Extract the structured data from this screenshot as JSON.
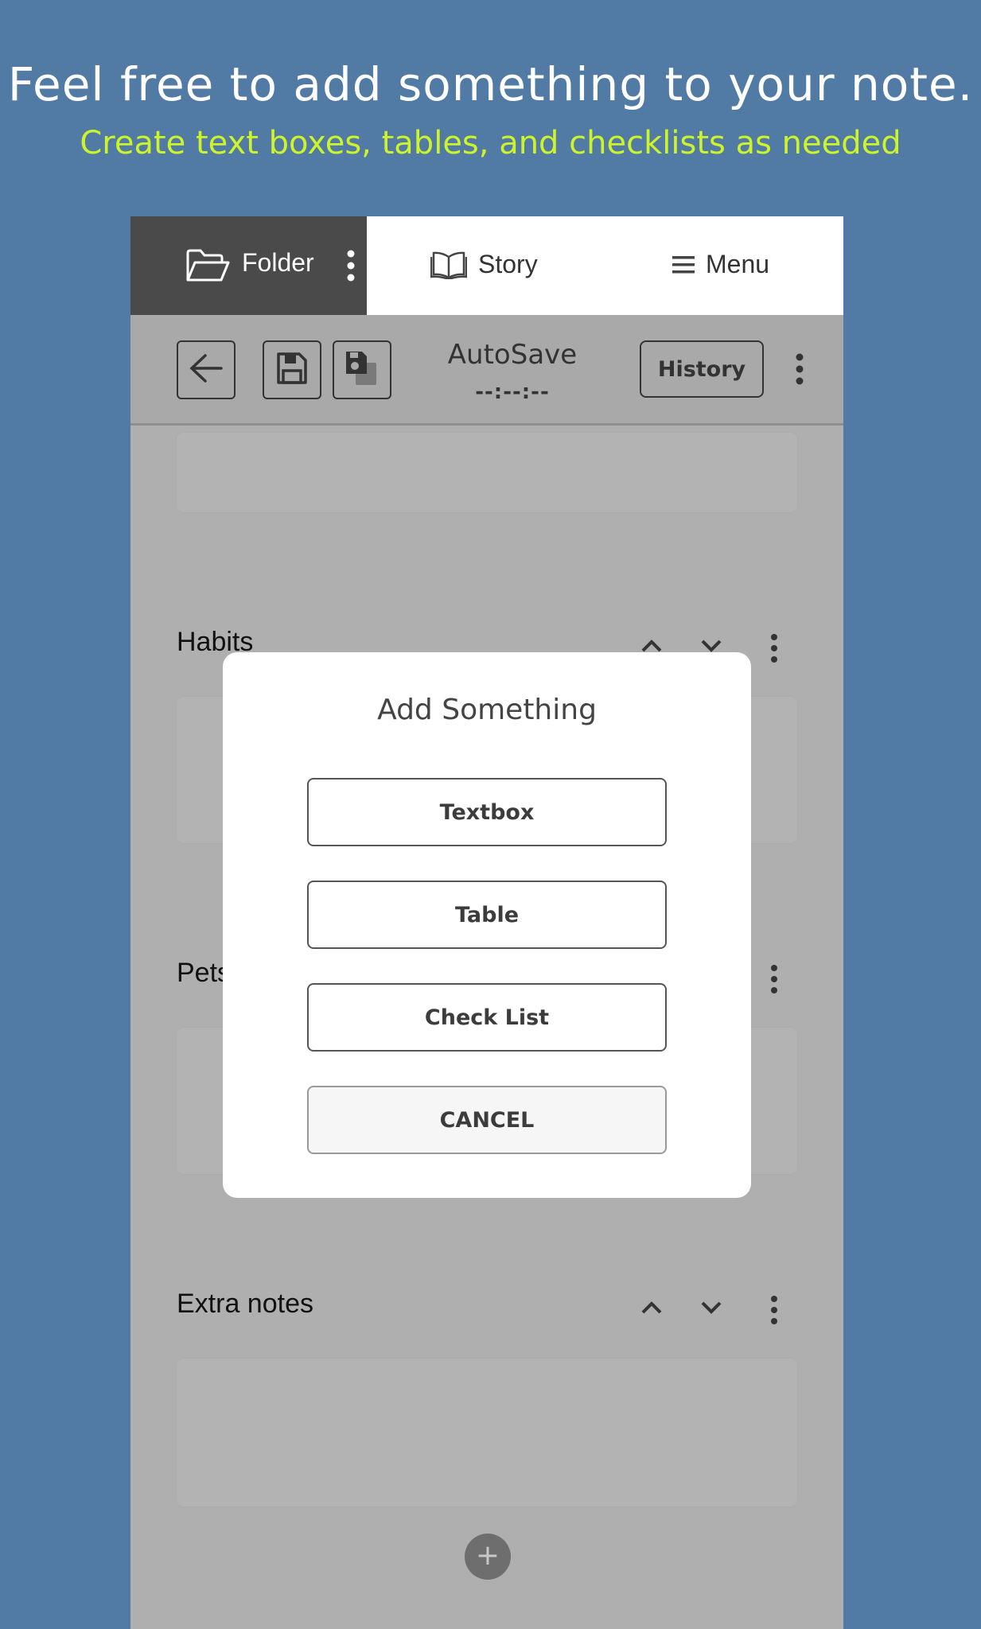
{
  "promo": {
    "title": "Feel free to add something to your note.",
    "subtitle": "Create text boxes, tables, and checklists as needed"
  },
  "topnav": {
    "folder": {
      "label": "Folder",
      "icon": "folder-open-icon"
    },
    "story": {
      "label": "Story",
      "icon": "book-open-icon"
    },
    "menu": {
      "label": "Menu",
      "icon": "hamburger-icon"
    }
  },
  "toolbar": {
    "back_icon": "arrow-left-icon",
    "save_icon": "floppy-disk-icon",
    "save_as_icon": "floppy-disk-copy-icon",
    "autosave_label": "AutoSave",
    "autosave_time": "--:--:--",
    "history_label": "History"
  },
  "sections": [
    {
      "title": "Habits"
    },
    {
      "title": "Pets"
    },
    {
      "title": "Extra notes"
    }
  ],
  "dialog": {
    "title": "Add Something",
    "buttons": {
      "textbox": "Textbox",
      "table": "Table",
      "checklist": "Check List",
      "cancel": "CANCEL"
    }
  },
  "fab": {
    "label": "+"
  },
  "colors": {
    "background": "#517ba4",
    "subtitle": "#cdf32a",
    "folder_tab": "#4a4a4a",
    "overlay_gray": "#afafaf"
  }
}
